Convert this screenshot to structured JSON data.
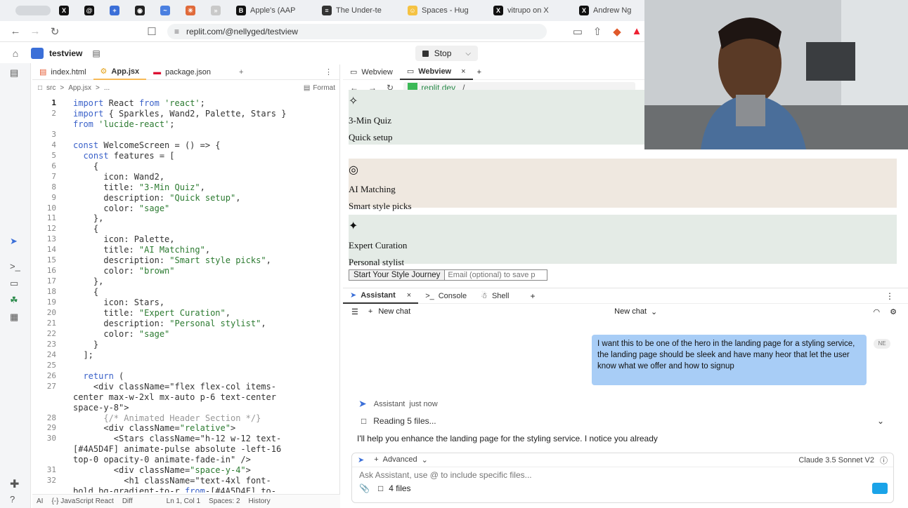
{
  "browser_tabs": [
    {
      "label": "",
      "icon": "x-icon"
    },
    {
      "label": "",
      "icon": "threads-icon"
    },
    {
      "label": "",
      "icon": "extension-icon"
    },
    {
      "label": "",
      "icon": "record-icon"
    },
    {
      "label": "",
      "icon": "bluesky-icon"
    },
    {
      "label": "",
      "icon": "claude-icon"
    },
    {
      "label": "",
      "icon": "rss-icon"
    },
    {
      "label": "Apple's (AAP",
      "icon": "b-icon"
    },
    {
      "label": "The Under-te",
      "icon": "doc-icon"
    },
    {
      "label": "Spaces - Hug",
      "icon": "hf-icon"
    },
    {
      "label": "vitrupo on X",
      "icon": "x-icon"
    },
    {
      "label": "Andrew Ng",
      "icon": "x-icon"
    }
  ],
  "address": {
    "url": "replit.com/@nellyged/testview"
  },
  "replit": {
    "project": "testview",
    "stop_label": "Stop"
  },
  "editor": {
    "tabs": [
      "index.html",
      "App.jsx",
      "package.json"
    ],
    "breadcrumb": [
      "src",
      ">",
      "App.jsx",
      ">",
      "..."
    ],
    "format_label": "Format",
    "lines": [
      {
        "n": "1",
        "t": "import React from 'react';"
      },
      {
        "n": "2",
        "t": "import { Sparkles, Wand2, Palette, Stars }"
      },
      {
        "n": "",
        "t": "from 'lucide-react';"
      },
      {
        "n": "3",
        "t": ""
      },
      {
        "n": "4",
        "t": "const WelcomeScreen = () => {"
      },
      {
        "n": "5",
        "t": "  const features = ["
      },
      {
        "n": "6",
        "t": "    {"
      },
      {
        "n": "7",
        "t": "      icon: Wand2,"
      },
      {
        "n": "8",
        "t": "      title: \"3-Min Quiz\","
      },
      {
        "n": "9",
        "t": "      description: \"Quick setup\","
      },
      {
        "n": "10",
        "t": "      color: \"sage\""
      },
      {
        "n": "11",
        "t": "    },"
      },
      {
        "n": "12",
        "t": "    {"
      },
      {
        "n": "13",
        "t": "      icon: Palette,"
      },
      {
        "n": "14",
        "t": "      title: \"AI Matching\","
      },
      {
        "n": "15",
        "t": "      description: \"Smart style picks\","
      },
      {
        "n": "16",
        "t": "      color: \"brown\""
      },
      {
        "n": "17",
        "t": "    },"
      },
      {
        "n": "18",
        "t": "    {"
      },
      {
        "n": "19",
        "t": "      icon: Stars,"
      },
      {
        "n": "20",
        "t": "      title: \"Expert Curation\","
      },
      {
        "n": "21",
        "t": "      description: \"Personal stylist\","
      },
      {
        "n": "22",
        "t": "      color: \"sage\""
      },
      {
        "n": "23",
        "t": "    }"
      },
      {
        "n": "24",
        "t": "  ];"
      },
      {
        "n": "25",
        "t": ""
      },
      {
        "n": "26",
        "t": "  return ("
      },
      {
        "n": "27",
        "t": "    <div className=\"flex flex-col items-"
      },
      {
        "n": "",
        "t": "center max-w-2xl mx-auto p-6 text-center"
      },
      {
        "n": "",
        "t": "space-y-8\">"
      },
      {
        "n": "28",
        "t": "      {/* Animated Header Section */}"
      },
      {
        "n": "29",
        "t": "      <div className=\"relative\">"
      },
      {
        "n": "30",
        "t": "        <Stars className=\"h-12 w-12 text-"
      },
      {
        "n": "",
        "t": "[#4A5D4F] animate-pulse absolute -left-16"
      },
      {
        "n": "",
        "t": "top-0 opacity-0 animate-fade-in\" />"
      },
      {
        "n": "31",
        "t": "        <div className=\"space-y-4\">"
      },
      {
        "n": "32",
        "t": "          <h1 className=\"text-4xl font-"
      },
      {
        "n": "",
        "t": "bold bg-gradient-to-r from-[#4A5D4F] to-"
      }
    ],
    "status": [
      "AI",
      "{-} JavaScript React",
      "Diff",
      "Ln 1, Col 1",
      "Spaces: 2",
      "History"
    ]
  },
  "webview": {
    "tabs": [
      "Webview",
      "Webview"
    ],
    "url_host": ".replit.dev",
    "url_path": "/",
    "features": [
      {
        "title": "3-Min Quiz",
        "desc": "Quick setup",
        "bg": "#e4ebe6"
      },
      {
        "title": "AI Matching",
        "desc": "Smart style picks",
        "bg": "#efe8e0"
      },
      {
        "title": "Expert Curation",
        "desc": "Personal stylist",
        "bg": "#e4ebe6"
      }
    ],
    "cta_label": "Start Your Style Journey",
    "email_placeholder": "Email (optional) to save p"
  },
  "assistant": {
    "tabs": [
      "Assistant",
      "Console",
      "Shell"
    ],
    "new_chat": "New chat",
    "new_chat_center": "New chat",
    "user_badge": "NE",
    "user_message": "I want this to be one of the hero in the landing page for a styling service, the landing page should be sleek and have many heor that let the user know what we offer and how to signup",
    "assistant_name": "Assistant",
    "timestamp": "just now",
    "reading": "Reading 5 files...",
    "reply": "I'll help you enhance the landing page for the styling service. I notice you already",
    "advanced": "Advanced",
    "model": "Claude 3.5 Sonnet V2",
    "input_placeholder": "Ask Assistant, use @ to include specific files...",
    "files": "4 files"
  },
  "colors": {
    "accent_blue": "#a8cdf6",
    "stop_bg": "#f0f0f0"
  }
}
